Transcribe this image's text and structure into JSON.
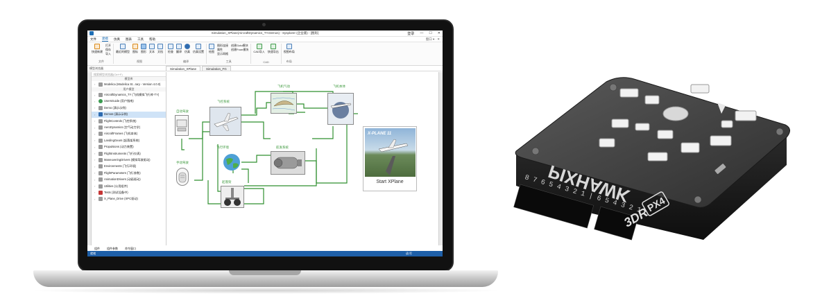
{
  "window": {
    "title": "Simulation_XPlane(AircraftDynamics_TY.Demos) - Sysplorer (企业版) - [图形]",
    "login": "登录",
    "minimize": "—",
    "maximize": "☐",
    "close": "✕"
  },
  "menu": {
    "items": [
      "文件",
      "建模",
      "仿真",
      "图表",
      "工具",
      "帮助"
    ],
    "active_index": 1,
    "right_label": "窗口 ▾ · ✕"
  },
  "ribbon": {
    "groups": [
      {
        "label": "文件",
        "items": [
          "快速新建"
        ],
        "small": [
          "打开",
          "保存",
          "导入"
        ]
      },
      {
        "label": "视图",
        "items": [
          "最近的模型",
          "图标",
          "图形",
          "文本",
          "文档"
        ]
      },
      {
        "label": "编译",
        "items": [
          "检查",
          "翻译",
          "仿真",
          "仿真设置"
        ]
      },
      {
        "label": "工具",
        "items": [
          "绘图"
        ],
        "small": [
          "图形连接",
          "属性",
          "显示网格"
        ],
        "small2": [
          "创建Goto模块",
          "创建From模块"
        ]
      },
      {
        "label": "CAD",
        "items": [
          "CAD导入",
          "快速导出"
        ]
      },
      {
        "label": "布局",
        "items": [
          "视图布局"
        ]
      }
    ]
  },
  "doc_tabs": [
    "Simulation_XPlane",
    "Simulation_FG"
  ],
  "browser": {
    "header": "模型浏览器",
    "search_placeholder": "搜索模型浏览器(Ctrl+F)",
    "section_lib": "模型库",
    "section_user": "用户模型",
    "items": [
      {
        "label": "Modelica (Modelica St...rary - Version 4.0.0)",
        "icon": "modelica-icon",
        "type": "gray"
      },
      {
        "label": "AircraftDynamics_TY (飞机模拟飞行库-TY)",
        "icon": "package-icon",
        "type": "gray"
      },
      {
        "label": "UsersGuide (用户指南)",
        "icon": "info-icon",
        "type": "book"
      },
      {
        "label": "Demo (演示示例)",
        "icon": "package-icon",
        "type": "gray"
      },
      {
        "label": "Demos (演示示例)",
        "icon": "play-icon",
        "type": "play",
        "selected": true
      },
      {
        "label": "FlightControls (飞控系统)",
        "icon": "package-icon",
        "type": "gray"
      },
      {
        "label": "AeroDynamics (空气动力学)",
        "icon": "package-icon",
        "type": "gray"
      },
      {
        "label": "AircraftFrames (飞机本体)",
        "icon": "package-icon",
        "type": "gray"
      },
      {
        "label": "LandingGears (起落架系统)",
        "icon": "package-icon",
        "type": "gray"
      },
      {
        "label": "Propulsions (动力装置)",
        "icon": "package-icon",
        "type": "gray"
      },
      {
        "label": "FlightInstruments (飞行仪表)",
        "icon": "package-icon",
        "type": "gray"
      },
      {
        "label": "ManeuveringDrivers (模拟驾驶驱动)",
        "icon": "package-icon",
        "type": "gray"
      },
      {
        "label": "Environments (飞行环境)",
        "icon": "package-icon",
        "type": "gray"
      },
      {
        "label": "FlightParameters (飞行参数)",
        "icon": "package-icon",
        "type": "gray"
      },
      {
        "label": "AnimationDrivers (动画驱动)",
        "icon": "package-icon",
        "type": "gray"
      },
      {
        "label": "Utilities (公用组件)",
        "icon": "package-icon",
        "type": "gray"
      },
      {
        "label": "Tests (测试设备中)",
        "icon": "test-icon",
        "type": "red"
      },
      {
        "label": "X_Plane_Drive (XPC驱动)",
        "icon": "package-icon",
        "type": "gray"
      }
    ]
  },
  "bottom_tabs": [
    "组件",
    "组件参数",
    "命令窗口"
  ],
  "status": {
    "left": "就绪",
    "right": "读/写"
  },
  "diagram": {
    "labels": {
      "autopilot": "自动驾驶",
      "manual": "手动驾驶",
      "flight_system": "飞控系统",
      "aero": "飞机气动",
      "airframe": "飞机本体",
      "environment": "飞行环境",
      "propulsion": "航发系统",
      "landing_gear": "起落架"
    },
    "xplane_caption": "Start  XPlane",
    "xplane_logo": "X-PLANE 11"
  },
  "board": {
    "brand": "PIXHAWK",
    "logo_3dr": "3DR",
    "logo_px4": "PX4",
    "pins": "8 7 6 5 4 3 2 1 | 6 5 4 3 2 1"
  }
}
